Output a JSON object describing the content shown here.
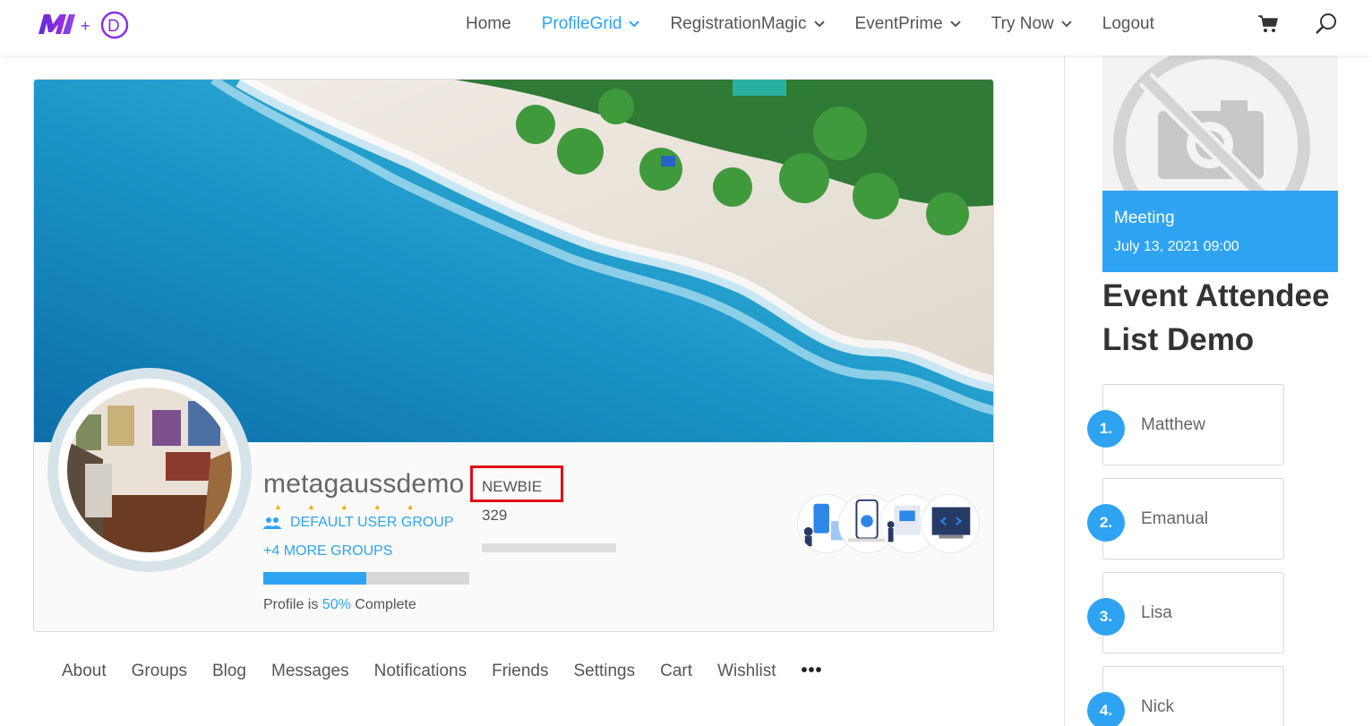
{
  "brand": {
    "logo_letter": "D",
    "logo_plus": "+"
  },
  "nav": {
    "items": [
      {
        "label": "Home",
        "dropdown": false,
        "active": false
      },
      {
        "label": "ProfileGrid",
        "dropdown": true,
        "active": true
      },
      {
        "label": "RegistrationMagic",
        "dropdown": true,
        "active": false
      },
      {
        "label": "EventPrime",
        "dropdown": true,
        "active": false
      },
      {
        "label": "Try Now",
        "dropdown": true,
        "active": false
      },
      {
        "label": "Logout",
        "dropdown": false,
        "active": false
      }
    ],
    "icons": [
      "cart-icon",
      "search-icon"
    ]
  },
  "profile": {
    "username": "metagaussdemo",
    "rank": "NEWBIE",
    "points": "329",
    "primary_group": "DEFAULT USER GROUP",
    "more_groups": "+4 MORE GROUPS",
    "completion": {
      "prefix": "Profile is ",
      "percent_text": "50%",
      "suffix": " Complete",
      "value": 0.5
    }
  },
  "tabs": [
    "About",
    "Groups",
    "Blog",
    "Messages",
    "Notifications",
    "Friends",
    "Settings",
    "Cart",
    "Wishlist"
  ],
  "more_tabs_icon": "more-dots-icon",
  "sidebar": {
    "event": {
      "title": "Meeting",
      "date": "July 13, 2021 09:00",
      "image_icon": "no-image-camera-icon"
    },
    "list_title": "Event Attendee List Demo",
    "attendees": [
      {
        "number": "1.",
        "name": "Matthew"
      },
      {
        "number": "2.",
        "name": "Emanual"
      },
      {
        "number": "3.",
        "name": "Lisa"
      },
      {
        "number": "4.",
        "name": "Nick"
      }
    ]
  },
  "colors": {
    "accent": "#2ea3f2",
    "highlight_box": "#e50914",
    "brand_purple": "#7b2ff7"
  }
}
